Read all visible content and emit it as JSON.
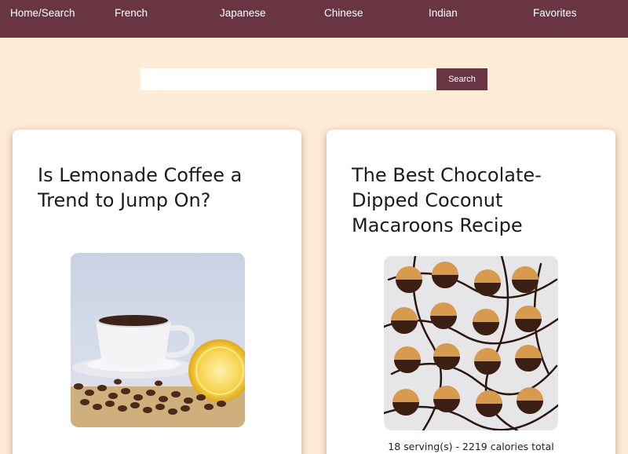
{
  "nav": {
    "links": [
      "Home/Search",
      "French",
      "Japanese",
      "Chinese",
      "Indian",
      "Favorites"
    ]
  },
  "search": {
    "placeholder": "",
    "value": "",
    "button_label": "Search"
  },
  "cards": [
    {
      "title": "Is Lemonade Coffee a Trend to Jump On?",
      "meta": ""
    },
    {
      "title": "The Best Chocolate-Dipped Coconut Macaroons Recipe",
      "meta": "18 serving(s) - 2219 calories total"
    }
  ],
  "colors": {
    "nav_background": "#6a3542",
    "page_background": "#ffecd6",
    "button_background": "#6a3542"
  }
}
